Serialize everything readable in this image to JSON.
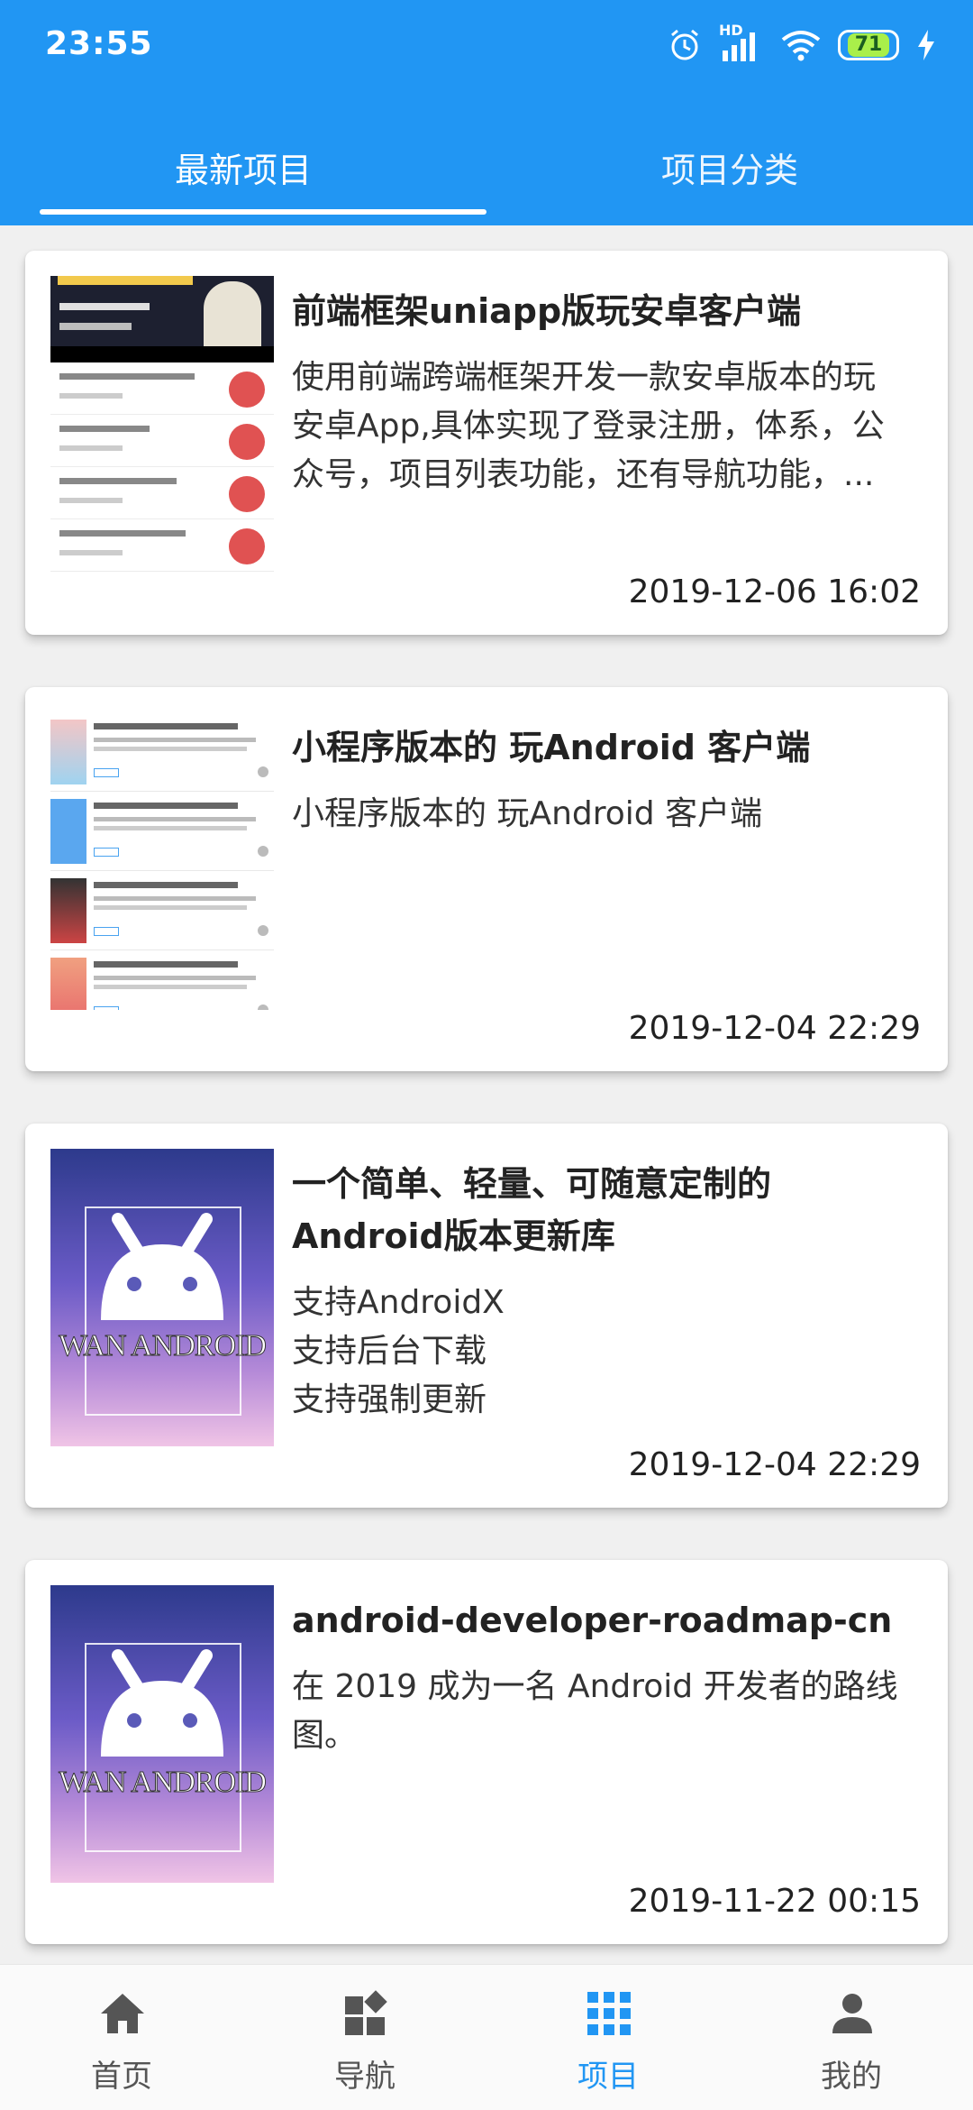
{
  "status_bar": {
    "time": "23:55",
    "network": "HD",
    "battery": "71"
  },
  "tabs": [
    {
      "label": "最新项目",
      "active": true
    },
    {
      "label": "项目分类",
      "active": false
    }
  ],
  "projects": [
    {
      "title": "前端框架uniapp版玩安卓客户端",
      "desc_lines": [
        "使用前端跨端框架开发一款安卓版本的玩",
        "安卓App,具体实现了登录注册，体系，公",
        "众号，项目列表功能，还有导航功能，..."
      ],
      "date": "2019-12-06 16:02"
    },
    {
      "title": "小程序版本的 玩Android 客户端",
      "desc_lines": [
        "小程序版本的 玩Android 客户端"
      ],
      "date": "2019-12-04 22:29"
    },
    {
      "title_lines": [
        "一个简单、轻量、可随意定制的",
        "Android版本更新库"
      ],
      "desc_lines": [
        " 支持AndroidX",
        " 支持后台下载",
        " 支持强制更新"
      ],
      "date": "2019-12-04 22:29",
      "poster_text": "WAN ANDROID"
    },
    {
      "title": "android-developer-roadmap-cn",
      "desc_lines": [
        "在 2019 成为一名 Android 开发者的路线",
        "图。"
      ],
      "date": "2019-11-22 00:15",
      "poster_text": "WAN ANDROID"
    }
  ],
  "bottom_nav": [
    {
      "label": "首页",
      "icon": "home-icon",
      "active": false
    },
    {
      "label": "导航",
      "icon": "dashboard-icon",
      "active": false
    },
    {
      "label": "项目",
      "icon": "apps-grid-icon",
      "active": true
    },
    {
      "label": "我的",
      "icon": "person-icon",
      "active": false
    }
  ],
  "colors": {
    "primary": "#2196f3",
    "inactive_nav": "#555555"
  }
}
